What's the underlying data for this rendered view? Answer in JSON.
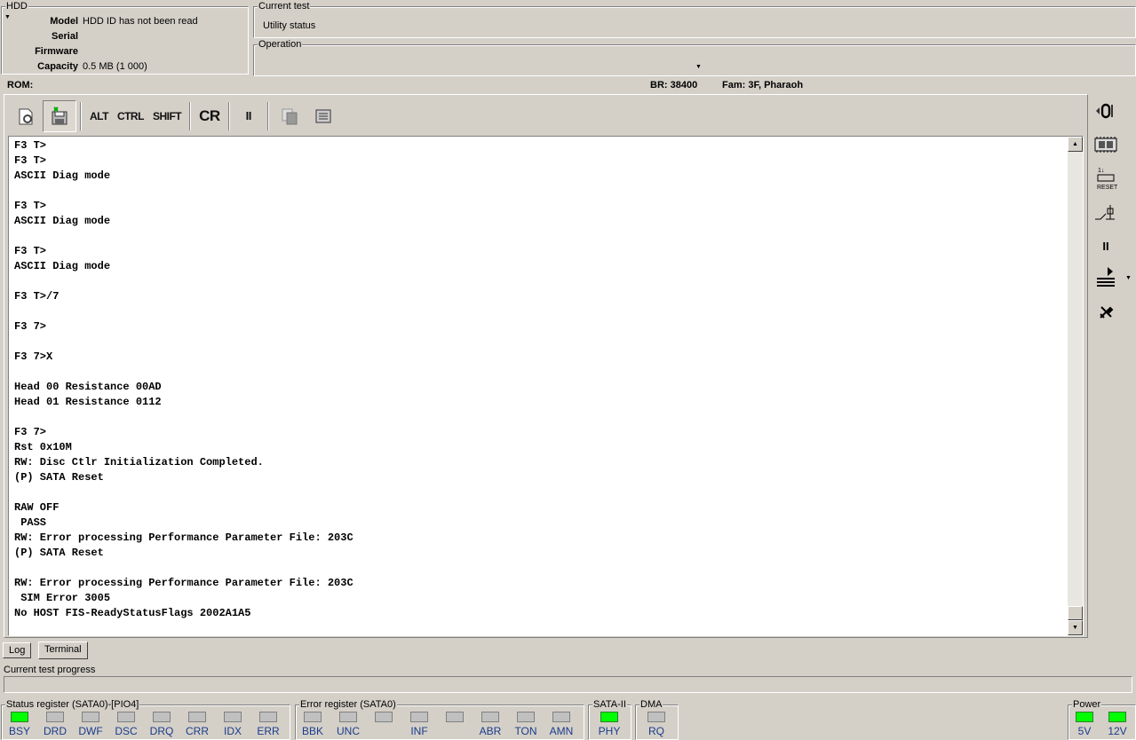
{
  "hdd": {
    "group_title": "HDD",
    "model_label": "Model",
    "model_value": "HDD ID has not been read",
    "serial_label": "Serial",
    "serial_value": "",
    "firmware_label": "Firmware",
    "firmware_value": "",
    "capacity_label": "Capacity",
    "capacity_value": "0.5 MB (1 000)"
  },
  "current_test": {
    "title": "Current test",
    "value": "Utility status"
  },
  "operation": {
    "title": "Operation",
    "value": ""
  },
  "status_bar": {
    "rom": "ROM:",
    "br": "BR: 38400",
    "fam": "Fam: 3F, Pharaoh"
  },
  "toolbar": {
    "alt": "ALT",
    "ctrl": "CTRL",
    "shift": "SHIFT",
    "cr": "CR",
    "pause": "II"
  },
  "terminal_lines": [
    "F3 T>",
    "F3 T>",
    "ASCII Diag mode",
    "",
    "F3 T>",
    "ASCII Diag mode",
    "",
    "F3 T>",
    "ASCII Diag mode",
    "",
    "F3 T>/7",
    "",
    "F3 7>",
    "",
    "F3 7>X",
    "",
    "Head 00 Resistance 00AD",
    "Head 01 Resistance 0112",
    "",
    "F3 7>",
    "Rst 0x10M",
    "RW: Disc Ctlr Initialization Completed.",
    "(P) SATA Reset",
    "",
    "RAW OFF",
    " PASS",
    "RW: Error processing Performance Parameter File: 203C",
    "(P) SATA Reset",
    "",
    "RW: Error processing Performance Parameter File: 203C",
    " SIM Error 3005",
    "No HOST FIS-ReadyStatusFlags 2002A1A5"
  ],
  "tabs": {
    "log": "Log",
    "terminal": "Terminal"
  },
  "progress": {
    "title": "Current test progress",
    "value": 0
  },
  "status_register": {
    "title": "Status register (SATA0)-[PIO4]",
    "leds": [
      {
        "label": "BSY",
        "on": true
      },
      {
        "label": "DRD",
        "on": false
      },
      {
        "label": "DWF",
        "on": false
      },
      {
        "label": "DSC",
        "on": false
      },
      {
        "label": "DRQ",
        "on": false
      },
      {
        "label": "CRR",
        "on": false
      },
      {
        "label": "IDX",
        "on": false
      },
      {
        "label": "ERR",
        "on": false
      }
    ]
  },
  "error_register": {
    "title": "Error register (SATA0)",
    "leds": [
      {
        "label": "BBK",
        "on": false
      },
      {
        "label": "UNC",
        "on": false
      },
      {
        "label": "",
        "on": false
      },
      {
        "label": "INF",
        "on": false
      },
      {
        "label": "",
        "on": false
      },
      {
        "label": "ABR",
        "on": false
      },
      {
        "label": "TON",
        "on": false
      },
      {
        "label": "AMN",
        "on": false
      }
    ]
  },
  "sata": {
    "title": "SATA-II",
    "label": "PHY",
    "on": true
  },
  "dma": {
    "title": "DMA",
    "label": "RQ",
    "on": false
  },
  "power": {
    "title": "Power",
    "leds": [
      {
        "label": "5V",
        "on": true
      },
      {
        "label": "12V",
        "on": true
      }
    ]
  },
  "colors": {
    "led_on": "#00ff00",
    "led_off": "#c0c0c0",
    "led_label": "#1a3c8c",
    "window_bg": "#d4d0c8"
  }
}
